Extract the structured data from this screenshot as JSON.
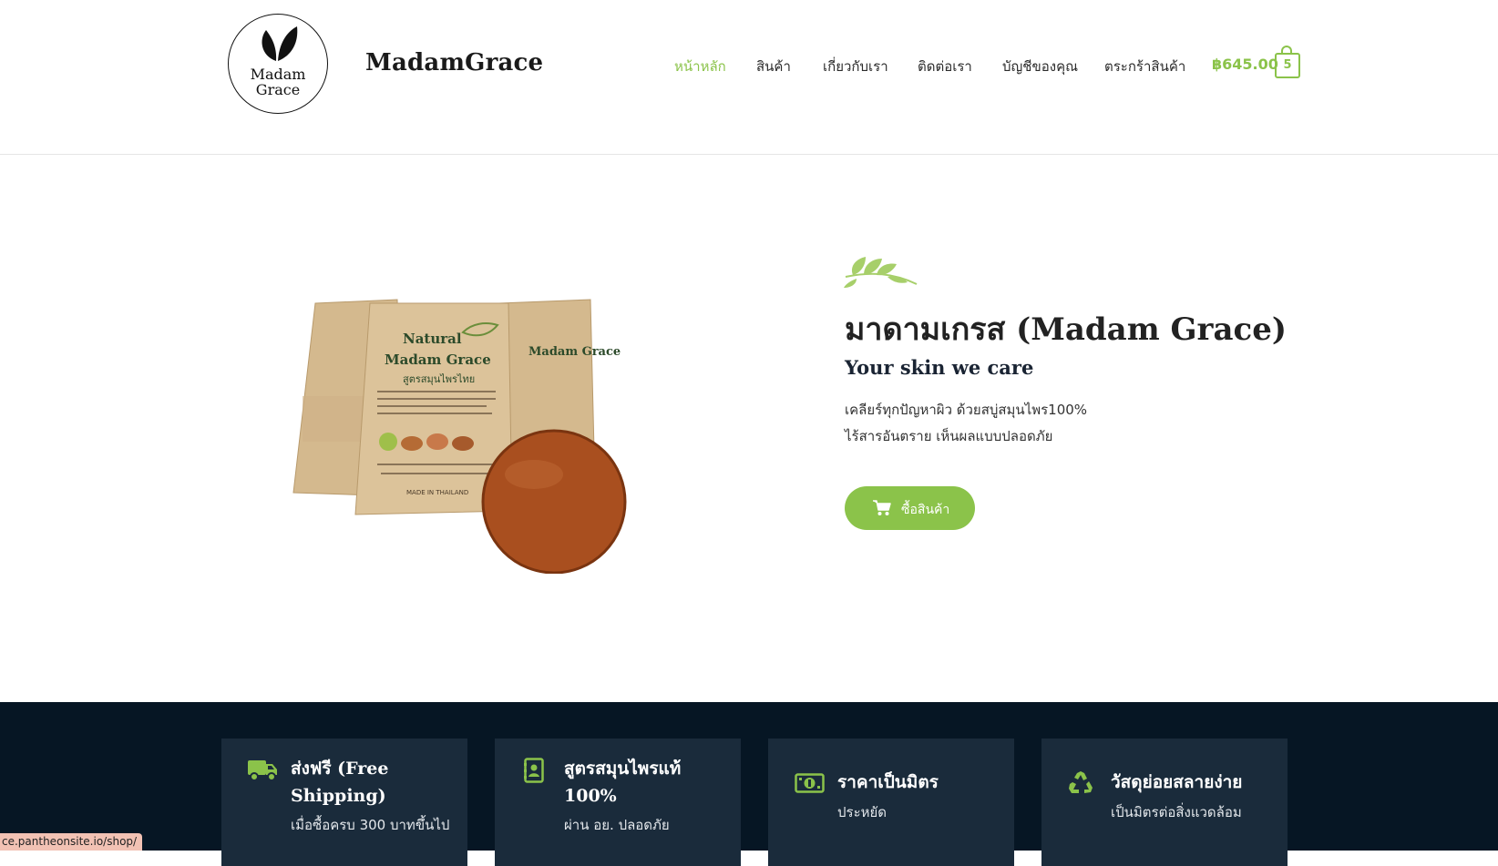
{
  "brand": {
    "logo_line1": "Madam",
    "logo_line2": "Grace",
    "site_title": "MadamGrace"
  },
  "nav": {
    "items": [
      {
        "label": "หน้าหลัก",
        "active": true
      },
      {
        "label": "สินค้า"
      },
      {
        "label": "เกี่ยวกับเรา"
      },
      {
        "label": "ติดต่อเรา"
      },
      {
        "label": "บัญชีของคุณ"
      },
      {
        "label": "ตระกร้าสินค้า"
      }
    ],
    "cart_total": "฿645.00",
    "cart_count": "5"
  },
  "hero": {
    "title": "มาดามเกรส (Madam Grace)",
    "subtitle": "Your skin we care",
    "line1": "เคลียร์ทุกปัญหาผิว ด้วยสบู่สมุนไพร100%",
    "line2": "ไร้สารอันตราย เห็นผลแบบปลอดภัย",
    "button_label": "ซื้อสินค้า",
    "image_text": {
      "pack_brand": "Madam Grace",
      "pack_natural": "Natural",
      "pack_thai": "สูตรสมุนไพรไทย",
      "made_in": "MADE IN THAILAND"
    }
  },
  "features": [
    {
      "title_line1": "ส่งฟรี (Free",
      "title_line2": "Shipping)",
      "desc": "เมื่อซื้อครบ 300 บาทขึ้นไป",
      "icon": "truck-icon"
    },
    {
      "title_line1": "สูตรสมุนไพรแท้",
      "title_line2": "100%",
      "desc": "ผ่าน อย. ปลอดภัย",
      "icon": "contact-book-icon"
    },
    {
      "title_line1": "ราคาเป็นมิตร",
      "desc": "ประหยัด",
      "icon": "money-bill-icon"
    },
    {
      "title_line1": "วัสดุย่อยสลายง่าย",
      "desc": "เป็นมิตรต่อสิ่งแวดล้อม",
      "icon": "recycle-icon"
    }
  ],
  "status_bar": {
    "url": "ce.pantheonsite.io/shop/"
  },
  "colors": {
    "accent": "#8bc34a",
    "dark_band": "#061624",
    "feature_card": "#1a2b3b"
  }
}
